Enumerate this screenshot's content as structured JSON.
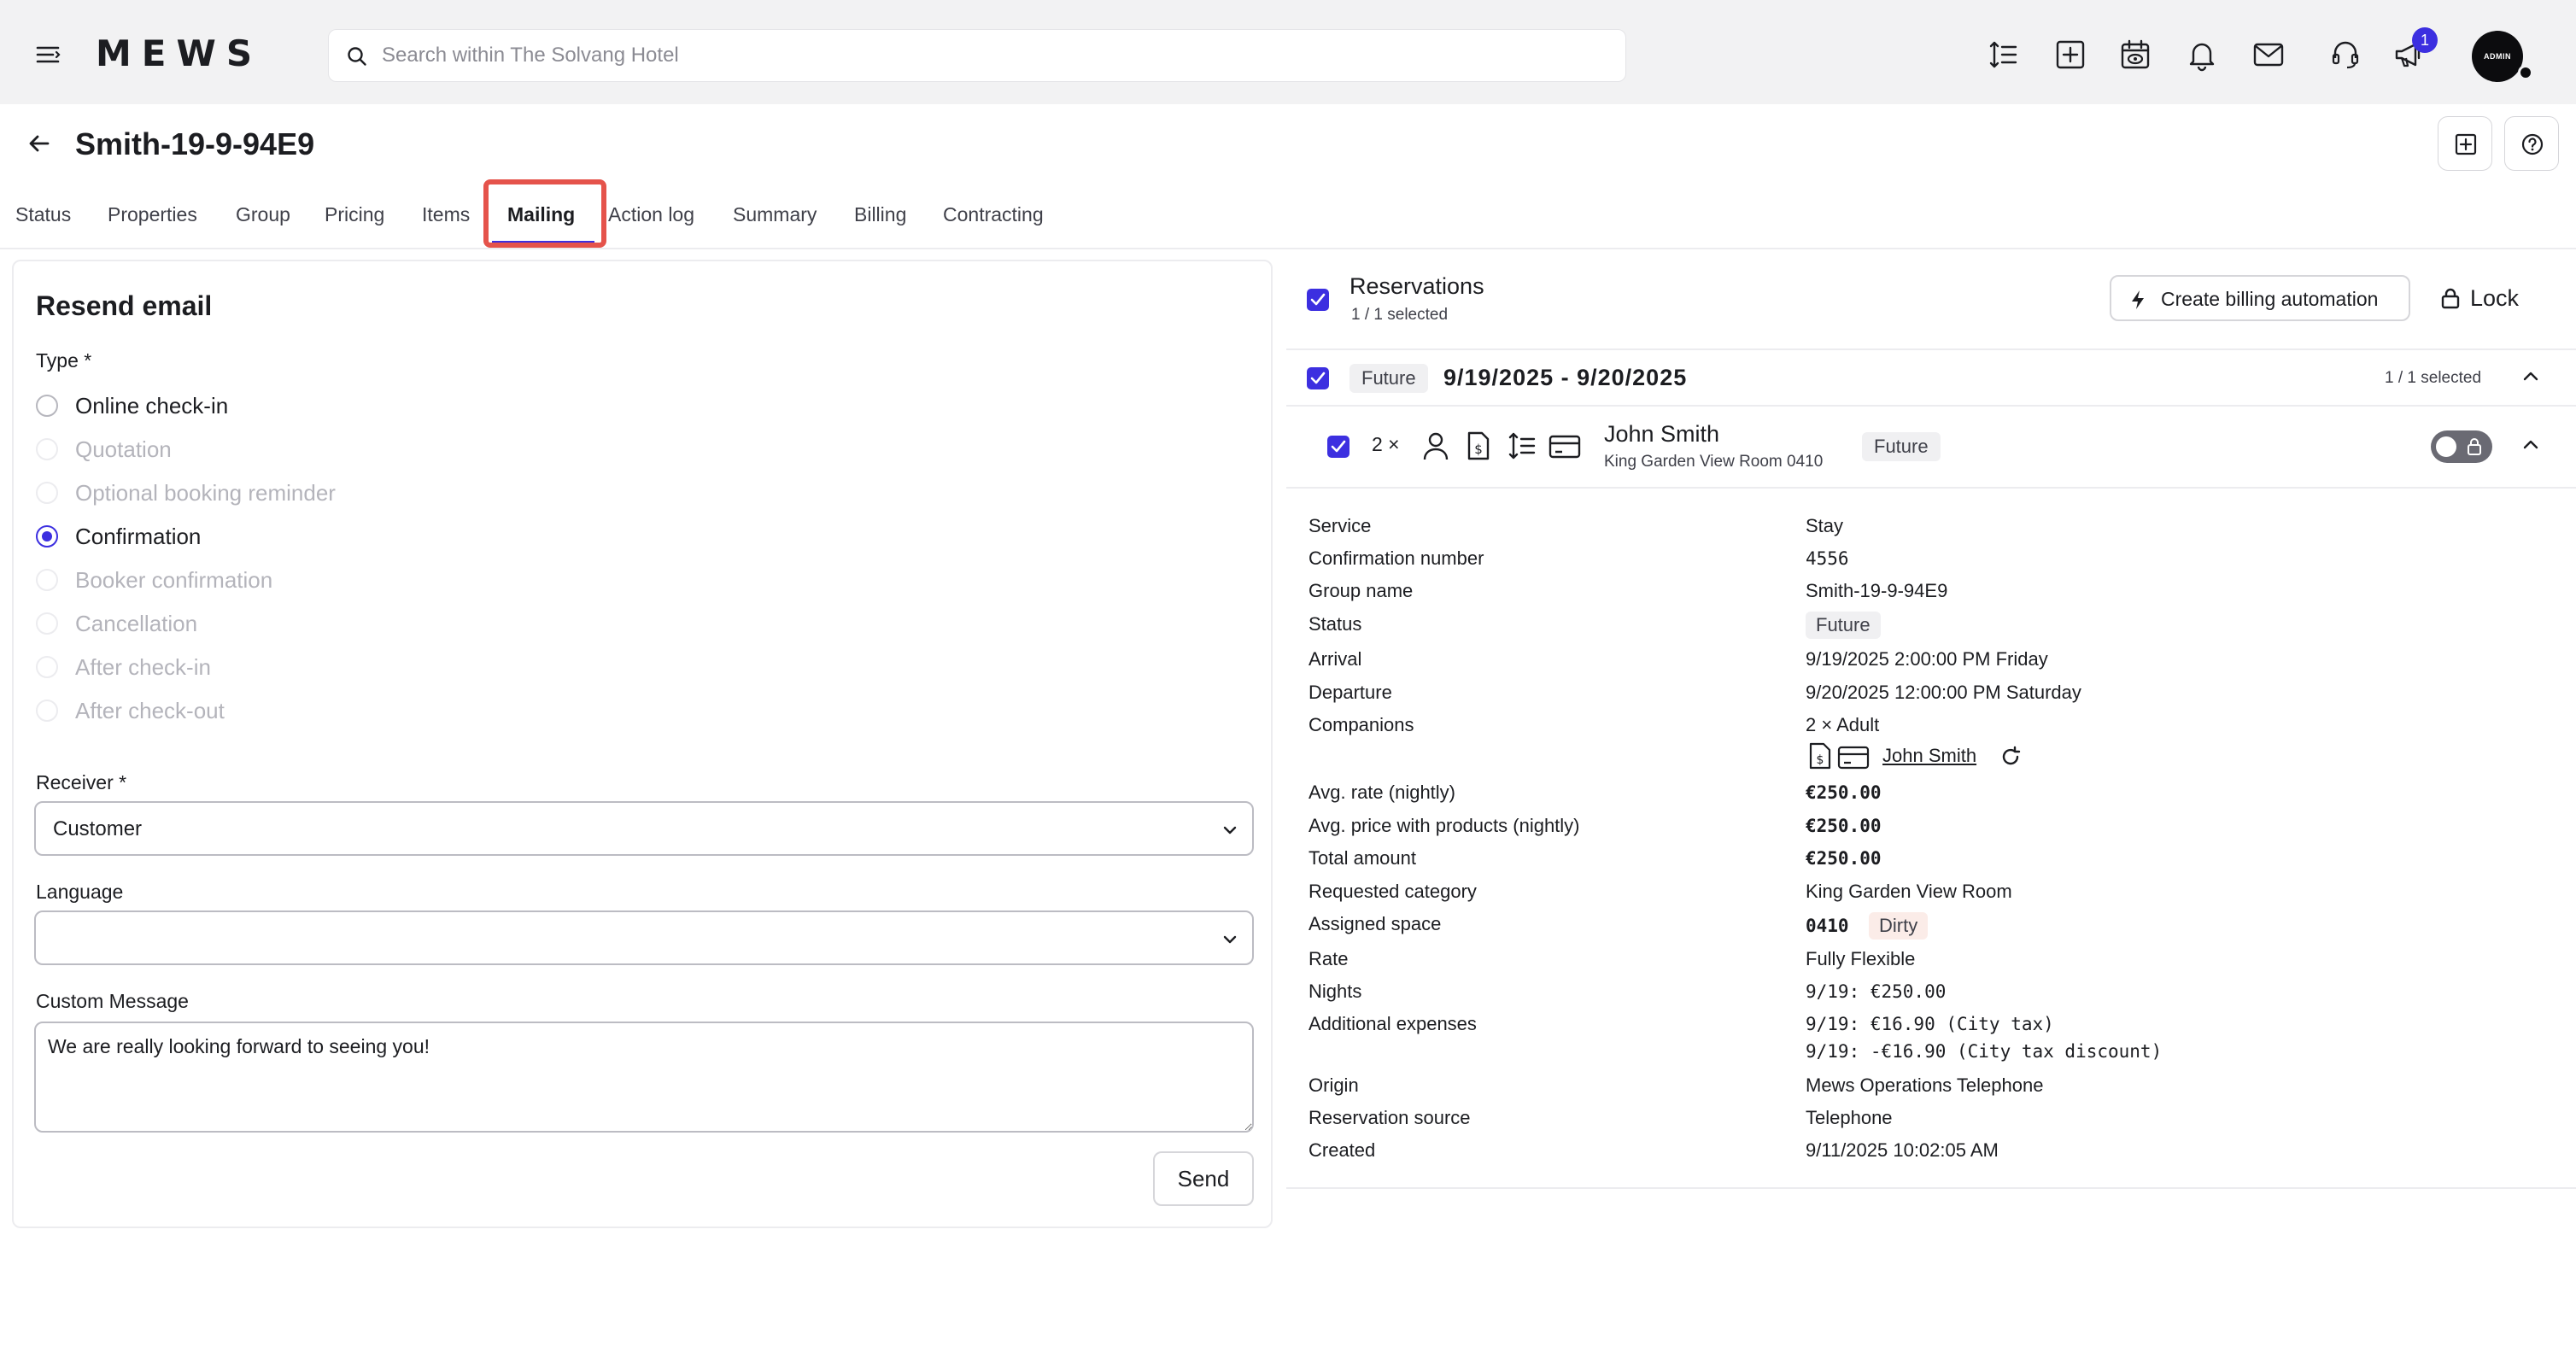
{
  "topbar": {
    "logo": "MEWS",
    "search_placeholder": "Search within The Solvang Hotel",
    "notification_count": "1",
    "avatar_label": "ADMIN"
  },
  "header": {
    "title": "Smith-19-9-94E9"
  },
  "tabs": [
    {
      "label": "Status"
    },
    {
      "label": "Properties"
    },
    {
      "label": "Group"
    },
    {
      "label": "Pricing"
    },
    {
      "label": "Items"
    },
    {
      "label": "Mailing",
      "active": true
    },
    {
      "label": "Action log"
    },
    {
      "label": "Summary"
    },
    {
      "label": "Billing"
    },
    {
      "label": "Contracting"
    }
  ],
  "resend": {
    "title": "Resend email",
    "type_label": "Type *",
    "types": [
      {
        "label": "Online check-in",
        "state": "enabled"
      },
      {
        "label": "Quotation",
        "state": "disabled"
      },
      {
        "label": "Optional booking reminder",
        "state": "disabled"
      },
      {
        "label": "Confirmation",
        "state": "checked"
      },
      {
        "label": "Booker confirmation",
        "state": "disabled"
      },
      {
        "label": "Cancellation",
        "state": "disabled"
      },
      {
        "label": "After check-in",
        "state": "disabled"
      },
      {
        "label": "After check-out",
        "state": "disabled"
      }
    ],
    "receiver_label": "Receiver *",
    "receiver_value": "Customer",
    "language_label": "Language",
    "language_value": "",
    "message_label": "Custom Message",
    "message_value": "We are really looking forward to seeing you!",
    "send_label": "Send"
  },
  "reservations": {
    "title": "Reservations",
    "selected": "1 / 1 selected",
    "billing_button": "Create billing automation",
    "lock_button": "Lock",
    "group": {
      "status": "Future",
      "dates": "9/19/2025 - 9/20/2025",
      "selected": "1 / 1 selected"
    },
    "item": {
      "qty": "2 ×",
      "guest": "John Smith",
      "room": "King Garden View Room 0410",
      "status": "Future"
    },
    "details": {
      "service_label": "Service",
      "service": "Stay",
      "confirmation_label": "Confirmation number",
      "confirmation": "4556",
      "group_label": "Group name",
      "group": "Smith-19-9-94E9",
      "status_label": "Status",
      "status": "Future",
      "arrival_label": "Arrival",
      "arrival": "9/19/2025 2:00:00 PM Friday",
      "departure_label": "Departure",
      "departure": "9/20/2025 12:00:00 PM Saturday",
      "companions_label": "Companions",
      "companions": "2 × Adult",
      "companion_name": "John Smith",
      "avg_rate_label": "Avg. rate (nightly)",
      "avg_rate": "€250.00",
      "avg_price_label": "Avg. price with products (nightly)",
      "avg_price": "€250.00",
      "total_label": "Total amount",
      "total": "€250.00",
      "category_label": "Requested category",
      "category": "King Garden View Room",
      "space_label": "Assigned space",
      "space": "0410",
      "space_status": "Dirty",
      "rate_label": "Rate",
      "rate": "Fully Flexible",
      "nights_label": "Nights",
      "nights": "9/19: €250.00",
      "expenses_label": "Additional expenses",
      "expense_1": "9/19: €16.90 (City tax)",
      "expense_2": "9/19: -€16.90 (City tax discount)",
      "origin_label": "Origin",
      "origin": "Mews Operations Telephone",
      "source_label": "Reservation source",
      "source": "Telephone",
      "created_label": "Created",
      "created": "9/11/2025 10:02:05 AM"
    }
  },
  "colors": {
    "accent": "#3c2fe0",
    "highlight": "#e5534b",
    "topbar_bg": "#f2f2f3"
  }
}
